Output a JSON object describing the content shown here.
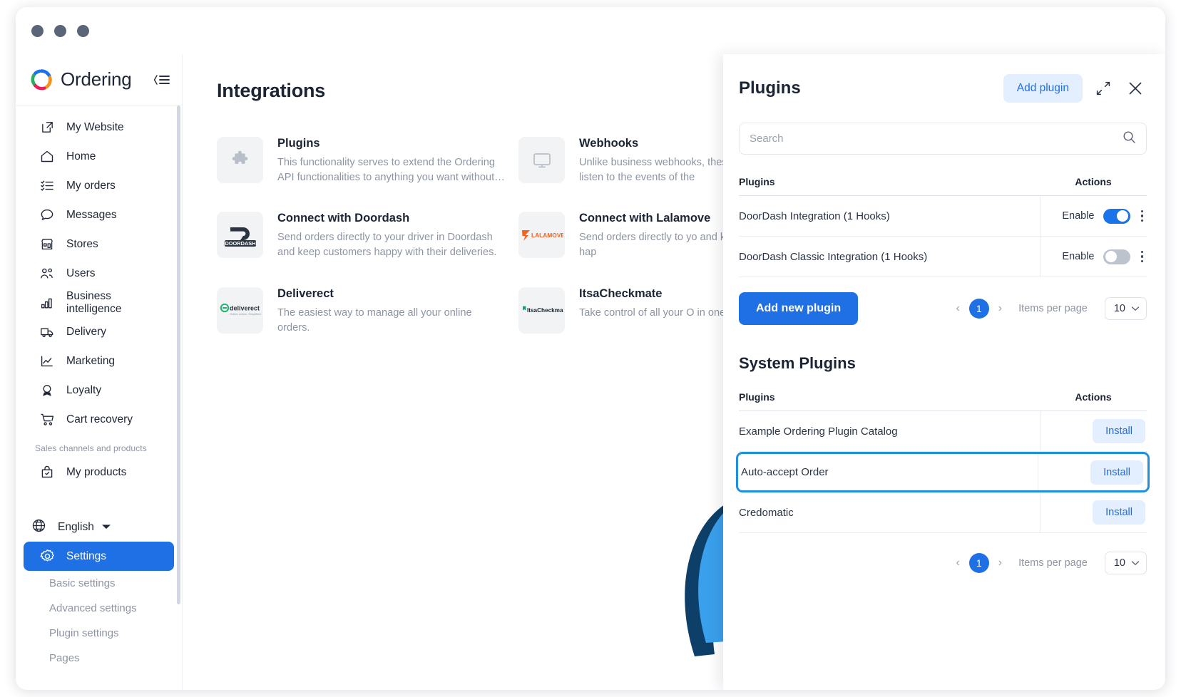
{
  "window": {
    "dots": 3
  },
  "sidebar": {
    "brand": "Ordering",
    "collapse_icon": "collapse-menu-icon",
    "items": [
      {
        "label": "My Website",
        "icon": "external-link-icon"
      },
      {
        "label": "Home",
        "icon": "home-icon"
      },
      {
        "label": "My orders",
        "icon": "list-icon"
      },
      {
        "label": "Messages",
        "icon": "chat-bubble-icon"
      },
      {
        "label": "Stores",
        "icon": "store-icon"
      },
      {
        "label": "Users",
        "icon": "users-icon"
      },
      {
        "label": "Business intelligence",
        "icon": "bar-chart-icon"
      },
      {
        "label": "Delivery",
        "icon": "truck-icon"
      },
      {
        "label": "Marketing",
        "icon": "line-chart-icon"
      },
      {
        "label": "Loyalty",
        "icon": "medal-icon"
      },
      {
        "label": "Cart recovery",
        "icon": "shopping-cart-icon"
      }
    ],
    "section_label": "Sales channels and products",
    "products_item": {
      "label": "My products",
      "icon": "bag-check-icon"
    },
    "language": {
      "label": "English",
      "icon": "globe-icon",
      "chevron": "chevron-down-icon"
    },
    "settings": {
      "label": "Settings",
      "icon": "gear-icon"
    },
    "sub_items": [
      {
        "label": "Basic settings"
      },
      {
        "label": "Advanced settings"
      },
      {
        "label": "Plugin settings"
      },
      {
        "label": "Pages"
      }
    ]
  },
  "main": {
    "title": "Integrations",
    "cards": [
      {
        "title": "Plugins",
        "desc": "This functionality serves to extend the Ordering API functionalities to anything you want without…",
        "icon": "puzzle-piece-icon"
      },
      {
        "title": "Webhooks",
        "desc": "Unlike business webhooks, these webhooks listen to the events of the",
        "icon": "monitor-icon"
      },
      {
        "title": "Connect with Doordash",
        "desc": "Send orders directly to your driver in Doordash and keep customers happy with their deliveries.",
        "icon": "doordash-logo",
        "logo_text": "DOORDASH"
      },
      {
        "title": "Connect with Lalamove",
        "desc": "Send orders directly to yo and keep customers hap",
        "icon": "lalamove-logo",
        "logo_text": "LALAMOVE"
      },
      {
        "title": "Deliverect",
        "desc": "The easiest way to manage all your online orders.",
        "icon": "deliverect-logo",
        "logo_text": "deliverect"
      },
      {
        "title": "ItsaCheckmate",
        "desc": "Take control of all your O in one place!",
        "icon": "itsacheckmate-logo",
        "logo_text": "ItsaCheckmate."
      }
    ]
  },
  "panel": {
    "title": "Plugins",
    "add_plugin_label": "Add plugin",
    "expand_icon": "expand-diagonal-icon",
    "close_icon": "close-icon",
    "search": {
      "placeholder": "Search",
      "value": "",
      "icon": "search-icon"
    },
    "table": {
      "col_name": "Plugins",
      "col_actions": "Actions",
      "rows": [
        {
          "name": "DoorDash Integration (1 Hooks)",
          "enable_label": "Enable",
          "enabled": true,
          "menu_icon": "kebab-menu-icon"
        },
        {
          "name": "DoorDash Classic Integration (1 Hooks)",
          "enable_label": "Enable",
          "enabled": false,
          "menu_icon": "kebab-menu-icon"
        }
      ]
    },
    "add_new_plugin_label": "Add new plugin",
    "pagination_top": {
      "prev_icon": "chevron-left-icon",
      "page": "1",
      "next_icon": "chevron-right-icon",
      "items_per_page_label": "Items per page",
      "items_per_page_value": "10",
      "chevron": "chevron-down-icon"
    },
    "system": {
      "title": "System Plugins",
      "col_name": "Plugins",
      "col_actions": "Actions",
      "rows": [
        {
          "name": "Example Ordering Plugin Catalog",
          "action_label": "Install",
          "highlighted": false
        },
        {
          "name": "Auto-accept Order",
          "action_label": "Install",
          "highlighted": true
        },
        {
          "name": "Credomatic",
          "action_label": "Install",
          "highlighted": false
        }
      ],
      "pagination": {
        "prev_icon": "chevron-left-icon",
        "page": "1",
        "next_icon": "chevron-right-icon",
        "items_per_page_label": "Items per page",
        "items_per_page_value": "10",
        "chevron": "chevron-down-icon"
      }
    }
  },
  "colors": {
    "accent": "#1f6fe5",
    "accent_soft": "#e3efff",
    "toggle_on": "#1a73e8",
    "toggle_off": "#bdc3cc",
    "highlight_border": "#1f8fe0",
    "arrow": "#3aa0ec",
    "arrow_shadow": "#0d3f68",
    "text_primary": "#1b2433",
    "text_muted": "#8d94a2"
  }
}
